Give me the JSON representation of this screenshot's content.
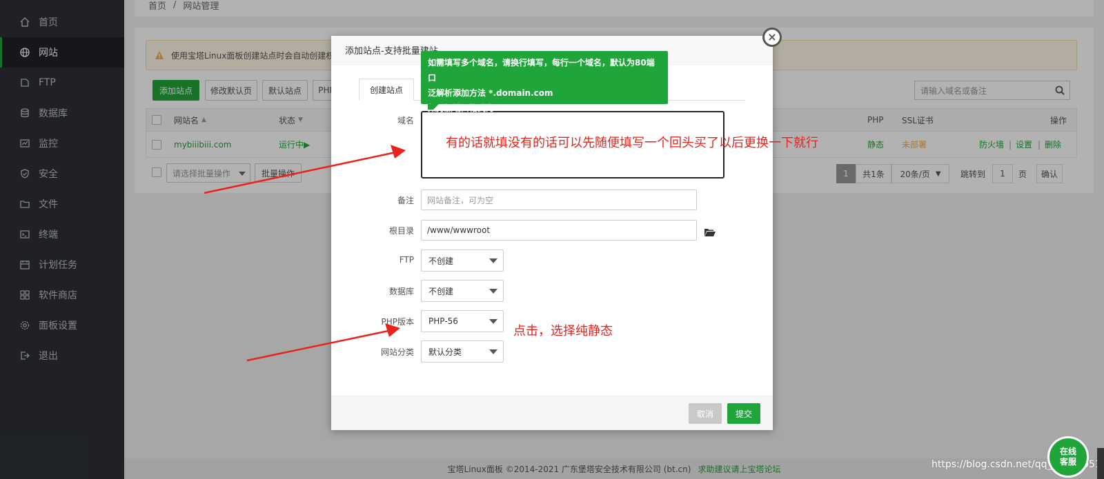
{
  "sidebar": {
    "items": [
      {
        "label": "首页",
        "icon": "home-icon"
      },
      {
        "label": "网站",
        "icon": "globe-icon",
        "active": true
      },
      {
        "label": "FTP",
        "icon": "ftp-icon"
      },
      {
        "label": "数据库",
        "icon": "database-icon"
      },
      {
        "label": "监控",
        "icon": "monitor-icon"
      },
      {
        "label": "安全",
        "icon": "shield-icon"
      },
      {
        "label": "文件",
        "icon": "folder-icon"
      },
      {
        "label": "终端",
        "icon": "terminal-icon"
      },
      {
        "label": "计划任务",
        "icon": "clock-icon"
      },
      {
        "label": "软件商店",
        "icon": "grid-icon"
      },
      {
        "label": "面板设置",
        "icon": "gear-icon"
      },
      {
        "label": "退出",
        "icon": "logout-icon"
      }
    ]
  },
  "breadcrumb": {
    "home": "首页",
    "sep": "/",
    "current": "网站管理"
  },
  "alert": {
    "text": "使用宝塔Linux面板创建站点时会自动创建权"
  },
  "toolbar": {
    "add_site": "添加站点",
    "modify_default": "修改默认页",
    "default_site": "默认站点",
    "php": "PHP"
  },
  "search": {
    "placeholder": "请输入域名或备注"
  },
  "table": {
    "headers": {
      "name": "网站名",
      "status": "状态",
      "php": "PHP",
      "ssl": "SSL证书",
      "ops": "操作"
    },
    "row": {
      "name": "mybiiibiii.com",
      "status": "运行中▶",
      "php": "静态",
      "ssl": "未部署",
      "firewall": "防火墙",
      "settings": "设置",
      "delete": "删除",
      "sep": "|"
    }
  },
  "batch": {
    "select_placeholder": "请选择批量操作",
    "button": "批量操作"
  },
  "pagination": {
    "current": "1",
    "total": "共1条",
    "per_page": "20条/页",
    "jump_label": "跳转到",
    "jump_value": "1",
    "page_unit": "页",
    "confirm": "确认"
  },
  "footer": {
    "copyright": "宝塔Linux面板 ©2014-2021 广东堡塔安全技术有限公司 (bt.cn)",
    "link": "求助建议请上宝塔论坛"
  },
  "modal": {
    "title": "添加站点-支持批量建站",
    "close": "×",
    "tab": "创建站点",
    "tooltip": {
      "line1": "如需填写多个域名，请换行填写，每行一个域名，默认为80端口",
      "line2": "泛解析添加方法 *.domain.com",
      "line3": "如另加端口格式为 www.domain.com:88"
    },
    "fields": {
      "domain_label": "域名",
      "remark_label": "备注",
      "remark_placeholder": "网站备注，可为空",
      "root_label": "根目录",
      "root_value": "/www/wwwroot",
      "ftp_label": "FTP",
      "ftp_value": "不创建",
      "db_label": "数据库",
      "db_value": "不创建",
      "php_label": "PHP版本",
      "php_value": "PHP-56",
      "category_label": "网站分类",
      "category_value": "默认分类"
    },
    "cancel": "取消",
    "submit": "提交"
  },
  "annotations": {
    "domain_note": "有的话就填没有的话可以先随便填写一个回头买了以后更换一下就行",
    "php_note": "点击，选择纯静态"
  },
  "chat": {
    "line1": "在线",
    "line2": "客服"
  },
  "watermark": "https://blog.csdn.net/qq_43682051",
  "colors": {
    "accent": "#20a53a",
    "annotation": "#e8221c",
    "sidebar": "#2d3038"
  }
}
